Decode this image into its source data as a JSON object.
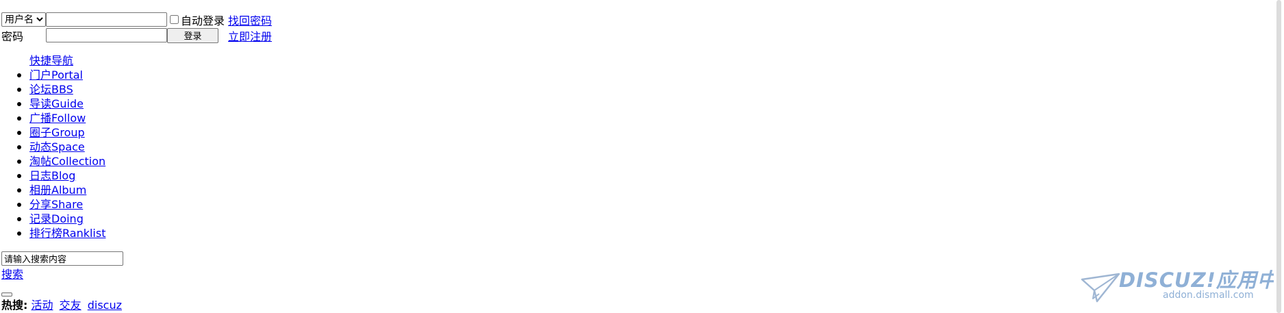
{
  "login": {
    "field_type": {
      "selected": "用户名",
      "options": [
        "用户名"
      ]
    },
    "username_value": "",
    "remember_label": "自动登录",
    "forgot_password_link": "找回密码",
    "password_label": "密码",
    "password_value": "",
    "login_button_label": "登录",
    "register_link": "立即注册"
  },
  "nav": {
    "title": "快捷导航",
    "items": [
      {
        "label": "门户Portal"
      },
      {
        "label": "论坛BBS"
      },
      {
        "label": "导读Guide"
      },
      {
        "label": "广播Follow"
      },
      {
        "label": "圈子Group"
      },
      {
        "label": "动态Space"
      },
      {
        "label": "淘帖Collection"
      },
      {
        "label": "日志Blog"
      },
      {
        "label": "相册Album"
      },
      {
        "label": "分享Share"
      },
      {
        "label": "记录Doing"
      },
      {
        "label": "排行榜Ranklist"
      }
    ]
  },
  "search": {
    "input_value": "请输入搜索内容",
    "link_label": "搜索"
  },
  "hot": {
    "label": "热搜:",
    "keywords": [
      "活动",
      "交友",
      "discuz"
    ]
  },
  "watermark": {
    "title": "DISCUZ!应用中心",
    "url": "addon.dismall.com",
    "color": "#8fb0d6"
  },
  "colors": {
    "link": "#0000ee",
    "background": "#ffffff"
  }
}
